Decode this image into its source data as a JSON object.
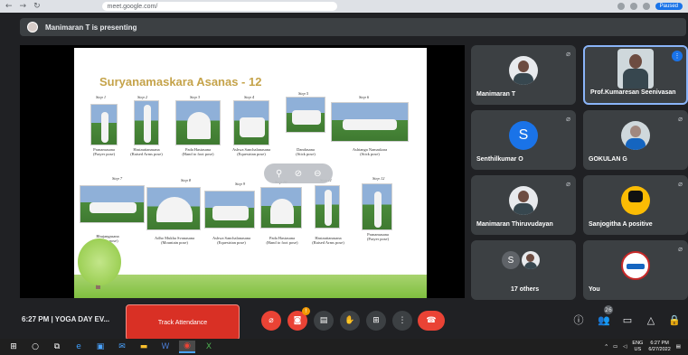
{
  "browser": {
    "url": "meet.google.com/",
    "profile_status": "Paused"
  },
  "presenting": {
    "text": "Manimaran T is presenting"
  },
  "slide": {
    "title": "Suryanamaskara Asanas - 12",
    "steps": [
      {
        "step": "Step 1",
        "name": "Pranamasana",
        "sub": "(Prayer pose)"
      },
      {
        "step": "Step 2",
        "name": "Hastauttanasana",
        "sub": "(Raised Arms pose)"
      },
      {
        "step": "Step 3",
        "name": "Pada Hastasana",
        "sub": "(Hand to foot pose)"
      },
      {
        "step": "Step 4",
        "name": "Ashwa Sanchalanasana",
        "sub": "(Equestrian pose)"
      },
      {
        "step": "Step 5",
        "name": "Dandasana",
        "sub": "(Stick pose)"
      },
      {
        "step": "Step 6",
        "name": "Ashtanga Namaskara",
        "sub": "(Stick pose)"
      },
      {
        "step": "Step 7",
        "name": "Bhujangasana",
        "sub": "(Cobra pose)"
      },
      {
        "step": "Step 8",
        "name": "Adho Mukha Svanasana",
        "sub": "(Mountain pose)"
      },
      {
        "step": "Step 9",
        "name": "Ashwa Sanchalanasana",
        "sub": "(Equestrian pose)"
      },
      {
        "step": "Step 10",
        "name": "Pada Hastasana",
        "sub": "(Hand to foot pose)"
      },
      {
        "step": "Step 11",
        "name": "Hastauttanasana",
        "sub": "(Raised Arms pose)"
      },
      {
        "step": "Step 12",
        "name": "Pranamasana",
        "sub": "(Prayer pose)"
      }
    ]
  },
  "participants": [
    {
      "name": "Manimaran T"
    },
    {
      "name": "Prof.Kumaresan Seenivasan"
    },
    {
      "name": "Senthilkumar O",
      "letter": "S"
    },
    {
      "name": "GOKULAN G"
    },
    {
      "name": "Manimaran Thiruvudayan"
    },
    {
      "name": "Sanjogitha A positive"
    },
    {
      "name": "17 others",
      "letter": "S"
    },
    {
      "name": "You"
    }
  ],
  "meeting": {
    "time": "6:27 PM",
    "separator": "|",
    "title": "YOGA DAY EV..."
  },
  "attendance": {
    "label": "Track Attendance"
  },
  "people_count": "26",
  "taskbar": {
    "lang": "ENG",
    "region": "US",
    "time": "6:27 PM",
    "date": "6/27/2022"
  }
}
